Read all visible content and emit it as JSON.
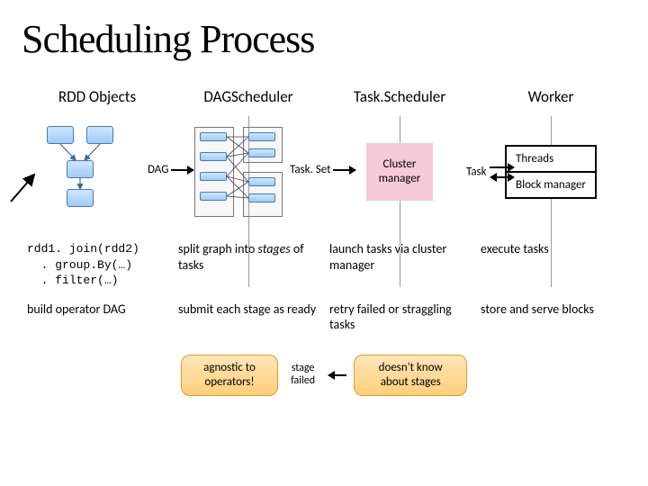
{
  "title": "Scheduling Process",
  "columns": {
    "c1": "RDD Objects",
    "c2": "DAGScheduler",
    "c3": "Task.Scheduler",
    "c4": "Worker"
  },
  "labels": {
    "dag": "DAG",
    "taskset": "Task. Set",
    "task": "Task",
    "cluster": "Cluster manager",
    "threads": "Threads",
    "block_mgr": "Block manager"
  },
  "code": {
    "line1": "rdd1. join(rdd2)",
    "line2": ". group.By(…)",
    "line3": ". filter(…)"
  },
  "row1": {
    "c1": "build operator DAG",
    "c2_a": "split graph into ",
    "c2_b": "stages",
    "c2_c": " of tasks",
    "c3": "launch tasks via cluster manager",
    "c4": "execute tasks"
  },
  "row2": {
    "c2": "submit each stage as ready",
    "c3": "retry failed or straggling tasks",
    "c4": "store and serve blocks"
  },
  "pills": {
    "p1": "agnostic to operators!",
    "mid": "stage failed",
    "p2": "doesn't know about stages"
  }
}
